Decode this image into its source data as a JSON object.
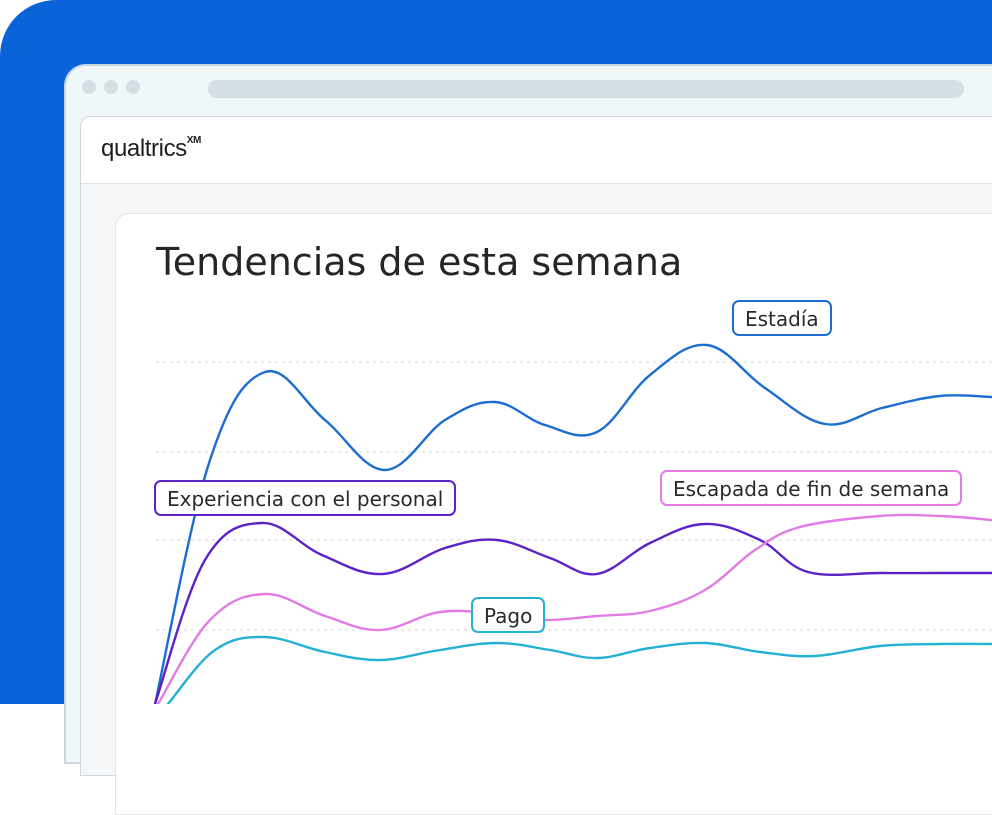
{
  "brand": {
    "name": "qualtrics",
    "mark": "XM"
  },
  "title": "Tendencias de esta semana",
  "colors": {
    "background": "#0a63d8",
    "estadia": "#1c6dd0",
    "personal": "#5b23c7",
    "escapada": "#e27be4",
    "pago": "#25b1d6"
  },
  "chart_data": {
    "type": "line",
    "title": "Tendencias de esta semana",
    "xlabel": "",
    "ylabel": "",
    "grid": true,
    "labels_inline": true,
    "series": [
      {
        "name": "Estadía",
        "color": "#1c6dd0",
        "points": [
          [
            155,
            704
          ],
          [
            210,
            460
          ],
          [
            265,
            372
          ],
          [
            325,
            420
          ],
          [
            385,
            470
          ],
          [
            445,
            420
          ],
          [
            495,
            402
          ],
          [
            545,
            425
          ],
          [
            597,
            432
          ],
          [
            650,
            375
          ],
          [
            707,
            345
          ],
          [
            765,
            388
          ],
          [
            825,
            424
          ],
          [
            882,
            408
          ],
          [
            940,
            396
          ],
          [
            992,
            397
          ]
        ]
      },
      {
        "name": "Experiencia con el personal",
        "color": "#5b23c7",
        "points": [
          [
            155,
            704
          ],
          [
            205,
            560
          ],
          [
            262,
            523
          ],
          [
            322,
            555
          ],
          [
            383,
            574
          ],
          [
            445,
            548
          ],
          [
            497,
            540
          ],
          [
            550,
            558
          ],
          [
            597,
            574
          ],
          [
            650,
            543
          ],
          [
            705,
            524
          ],
          [
            760,
            540
          ],
          [
            808,
            572
          ],
          [
            880,
            573
          ],
          [
            940,
            573
          ],
          [
            992,
            573
          ]
        ]
      },
      {
        "name": "Escapada de fin de semana",
        "color": "#e27be4",
        "points": [
          [
            158,
            704
          ],
          [
            210,
            620
          ],
          [
            265,
            594
          ],
          [
            325,
            616
          ],
          [
            380,
            630
          ],
          [
            440,
            612
          ],
          [
            497,
            614
          ],
          [
            545,
            620
          ],
          [
            597,
            616
          ],
          [
            650,
            611
          ],
          [
            705,
            590
          ],
          [
            755,
            550
          ],
          [
            800,
            527
          ],
          [
            880,
            516
          ],
          [
            940,
            516
          ],
          [
            992,
            520
          ]
        ]
      },
      {
        "name": "Pago",
        "color": "#25b1d6",
        "points": [
          [
            168,
            704
          ],
          [
            215,
            650
          ],
          [
            265,
            637
          ],
          [
            325,
            652
          ],
          [
            380,
            660
          ],
          [
            440,
            650
          ],
          [
            497,
            643
          ],
          [
            550,
            650
          ],
          [
            597,
            658
          ],
          [
            650,
            648
          ],
          [
            705,
            643
          ],
          [
            760,
            652
          ],
          [
            815,
            656
          ],
          [
            880,
            646
          ],
          [
            940,
            644
          ],
          [
            992,
            644
          ]
        ]
      }
    ],
    "gridlines_y": [
      362,
      452,
      540,
      630
    ]
  },
  "labels": [
    {
      "text": "Estadía",
      "series": "estadia"
    },
    {
      "text": "Experiencia con el personal",
      "series": "personal"
    },
    {
      "text": "Escapada de fin de semana",
      "series": "escapada"
    },
    {
      "text": "Pago",
      "series": "pago"
    }
  ]
}
